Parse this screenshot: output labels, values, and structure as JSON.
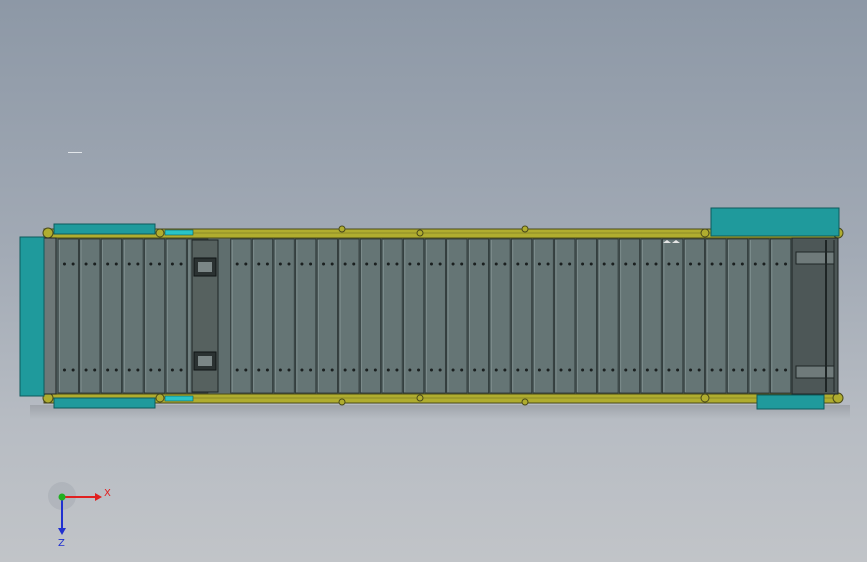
{
  "window": {
    "background_top": "#8d98a6",
    "background_bottom": "#c1c4c8"
  },
  "model": {
    "frame_color": "#b0ad2f",
    "frame_edge": "#4a4a1a",
    "guard_color": "#1f9a9c",
    "guard_edge": "#0d5a5c",
    "bed_color": "#5f6e6e",
    "slat_color": "#657575",
    "slat_edge": "#2a3333",
    "bolt_color": "#1a1f1f",
    "slat_count": 34,
    "bolt_rows": 2
  },
  "triad": {
    "x_label": "X",
    "z_label": "Z",
    "x_color": "#e02020",
    "y_color": "#20b020",
    "z_color": "#2030d0"
  }
}
